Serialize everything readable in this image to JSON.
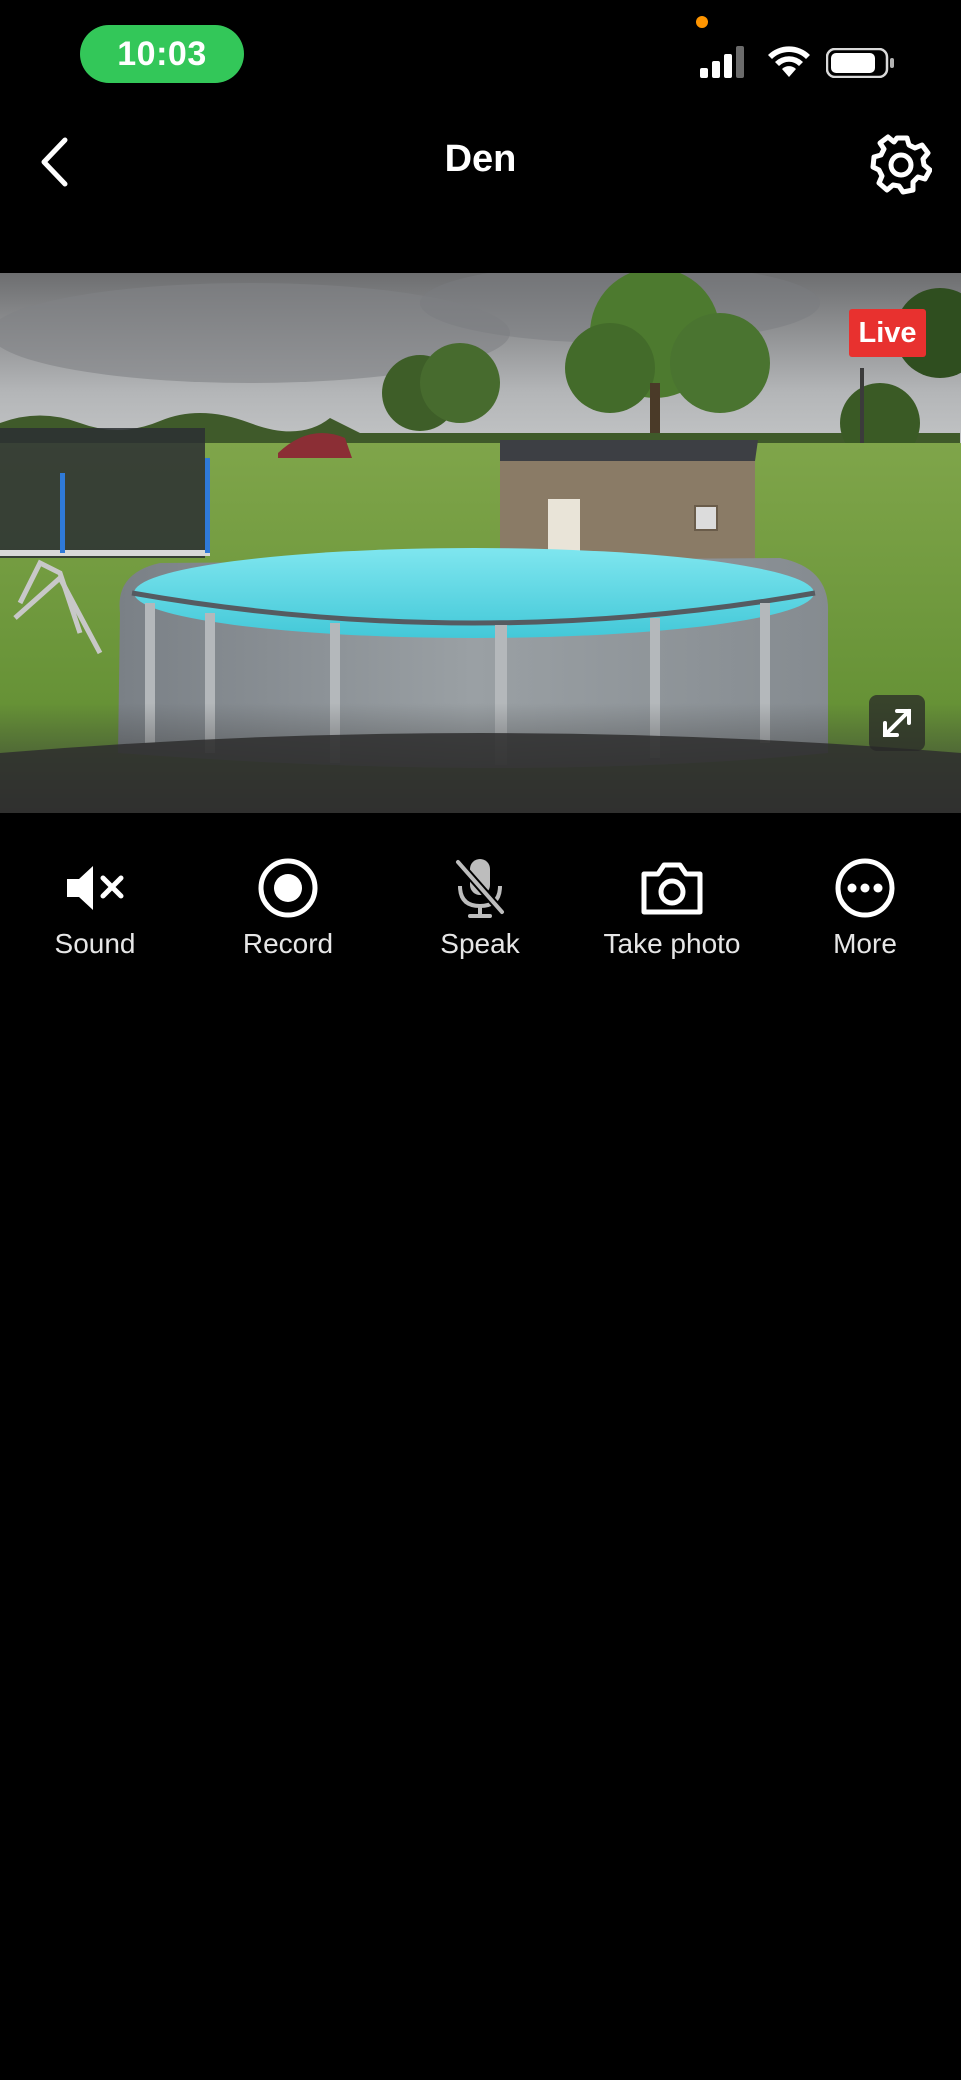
{
  "status_bar": {
    "time": "10:03"
  },
  "nav": {
    "title": "Den"
  },
  "feed": {
    "live_label": "Live"
  },
  "controls": [
    {
      "label": "Sound",
      "icon": "speaker-muted-icon"
    },
    {
      "label": "Record",
      "icon": "record-icon"
    },
    {
      "label": "Speak",
      "icon": "microphone-off-icon"
    },
    {
      "label": "Take photo",
      "icon": "camera-icon"
    },
    {
      "label": "More",
      "icon": "more-icon"
    }
  ],
  "colors": {
    "time_pill": "#33c759",
    "live_badge": "#e8312f",
    "background": "#000000"
  }
}
